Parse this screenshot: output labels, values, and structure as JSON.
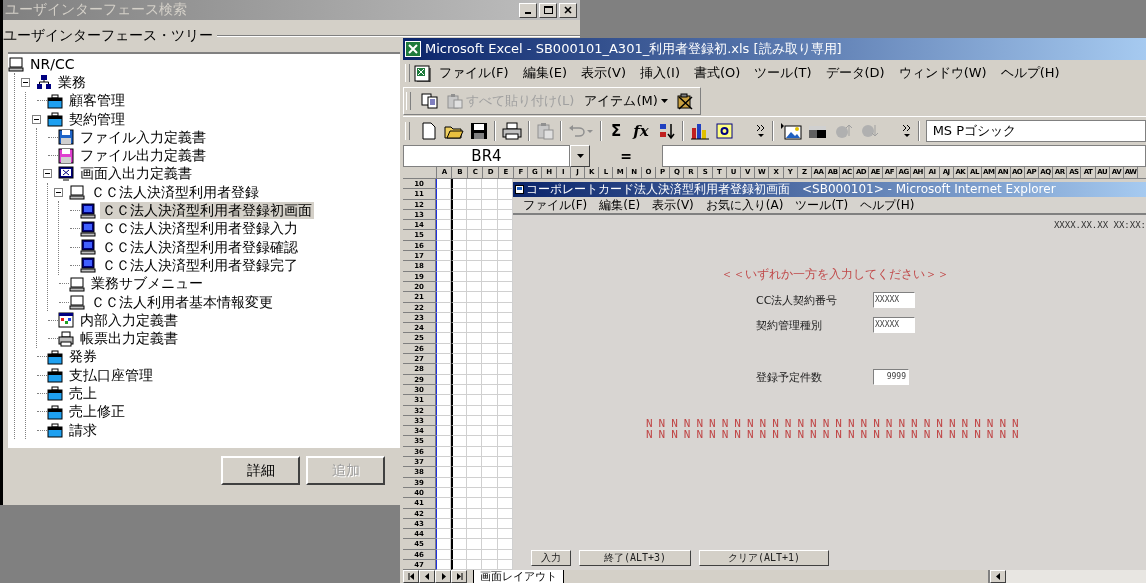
{
  "search_window": {
    "title": "ユーザインターフェース検索",
    "tree_label": "ユーザインターフェース・ツリー",
    "tree": [
      {
        "label": "NR/CC",
        "kind": "system",
        "selected": false,
        "children": [
          {
            "label": "業務",
            "kind": "group",
            "expanded": true,
            "selected": false,
            "children": [
              {
                "label": "顧客管理",
                "kind": "folder",
                "selected": false
              },
              {
                "label": "契約管理",
                "kind": "folder",
                "expanded": true,
                "selected": false,
                "children": [
                  {
                    "label": "ファイル入力定義書",
                    "kind": "file-input",
                    "selected": false
                  },
                  {
                    "label": "ファイル出力定義書",
                    "kind": "file-output",
                    "selected": false
                  },
                  {
                    "label": "画面入出力定義書",
                    "kind": "screen-def",
                    "expanded": true,
                    "selected": false,
                    "children": [
                      {
                        "label": "ＣＣ法人決済型利用者登録",
                        "kind": "screen-set",
                        "expanded": true,
                        "selected": false,
                        "children": [
                          {
                            "label": "ＣＣ法人決済型利用者登録初画面",
                            "kind": "screen",
                            "selected": true
                          },
                          {
                            "label": "ＣＣ法人決済型利用者登録入力",
                            "kind": "screen",
                            "selected": false
                          },
                          {
                            "label": "ＣＣ法人決済型利用者登録確認",
                            "kind": "screen",
                            "selected": false
                          },
                          {
                            "label": "ＣＣ法人決済型利用者登録完了",
                            "kind": "screen",
                            "selected": false
                          }
                        ]
                      },
                      {
                        "label": "業務サブメニュー",
                        "kind": "screen-set",
                        "selected": false
                      },
                      {
                        "label": "ＣＣ法人利用者基本情報変更",
                        "kind": "screen-set",
                        "selected": false
                      }
                    ]
                  },
                  {
                    "label": "内部入力定義書",
                    "kind": "internal",
                    "selected": false
                  },
                  {
                    "label": "帳票出力定義書",
                    "kind": "report",
                    "selected": false
                  }
                ]
              },
              {
                "label": "発券",
                "kind": "folder",
                "selected": false
              },
              {
                "label": "支払口座管理",
                "kind": "folder",
                "selected": false
              },
              {
                "label": "売上",
                "kind": "folder",
                "selected": false
              },
              {
                "label": "売上修正",
                "kind": "folder",
                "selected": false
              },
              {
                "label": "請求",
                "kind": "folder",
                "selected": false
              }
            ]
          }
        ]
      }
    ],
    "buttons": [
      {
        "label": "詳細",
        "disabled": false
      },
      {
        "label": "追加",
        "disabled": true
      }
    ]
  },
  "excel": {
    "title": "Microsoft Excel - SB000101_A301_利用者登録初.xls  [読み取り専用]",
    "menu": [
      "ファイル(F)",
      "編集(E)",
      "表示(V)",
      "挿入(I)",
      "書式(O)",
      "ツール(T)",
      "データ(D)",
      "ウィンドウ(W)",
      "ヘルプ(H)"
    ],
    "clipboard_toolbar": {
      "paste_all": {
        "label": "すべて貼り付け(L)",
        "disabled": true
      },
      "items_button": "アイテム(M)"
    },
    "standard_toolbar": {
      "autosum": "Σ",
      "function": "fx",
      "font": "MS Pゴシック"
    },
    "name_box": "BR4",
    "formula_sign": "=",
    "columns": [
      "A",
      "B",
      "C",
      "D",
      "E",
      "F",
      "G",
      "H",
      "I",
      "J",
      "K",
      "L",
      "M",
      "N",
      "O",
      "P",
      "Q",
      "R",
      "S",
      "T",
      "U",
      "V",
      "W",
      "X",
      "Y",
      "Z",
      "AA",
      "AB",
      "AC",
      "AD",
      "AE",
      "AF",
      "AG",
      "AH",
      "AI",
      "AJ",
      "AK",
      "AL",
      "AM",
      "AN",
      "AO",
      "AP",
      "AQ",
      "AR",
      "AS",
      "AT",
      "AU",
      "AV",
      "AW"
    ],
    "rows": [
      "10",
      "11",
      "12",
      "13",
      "14",
      "15",
      "16",
      "17",
      "18",
      "19",
      "20",
      "21",
      "22",
      "23",
      "24",
      "25",
      "26",
      "27",
      "28",
      "29",
      "30",
      "31",
      "32",
      "33",
      "34",
      "35",
      "36",
      "37",
      "38",
      "39",
      "40",
      "41",
      "42",
      "43",
      "44",
      "45",
      "46",
      "47"
    ],
    "embedded_window": {
      "title": "コーポレートカード法人決済型利用者登録初画面　<SB000101> - Microsoft Internet Explorer",
      "menu": [
        "ファイル(F)",
        "編集(E)",
        "表示(V)",
        "お気に入り(A)",
        "ツール(T)",
        "ヘルプ(H)"
      ],
      "timestamp": "XXXX.XX.XX XX:XX:",
      "prompt": "＜＜いずれか一方を入力してください＞＞",
      "fields": [
        {
          "label": "CC法人契約番号",
          "value": "XXXXX"
        },
        {
          "label": "契約管理種別",
          "value": "XXXXX"
        }
      ],
      "count_field": {
        "label": "登録予定件数",
        "value": "9999"
      },
      "message_lines": [
        "NNNNNNNNNNNNNNNNNNNNNNNNNNNNNN",
        "NNNNNNNNNNNNNNNNNNNNNNNNNNNNNN"
      ],
      "buttons": [
        "入力",
        "終了(ALT+3)",
        "クリア(ALT+1)"
      ]
    },
    "sheet_tabs": [
      {
        "label": "画面レイアウト",
        "selected": true
      }
    ]
  }
}
